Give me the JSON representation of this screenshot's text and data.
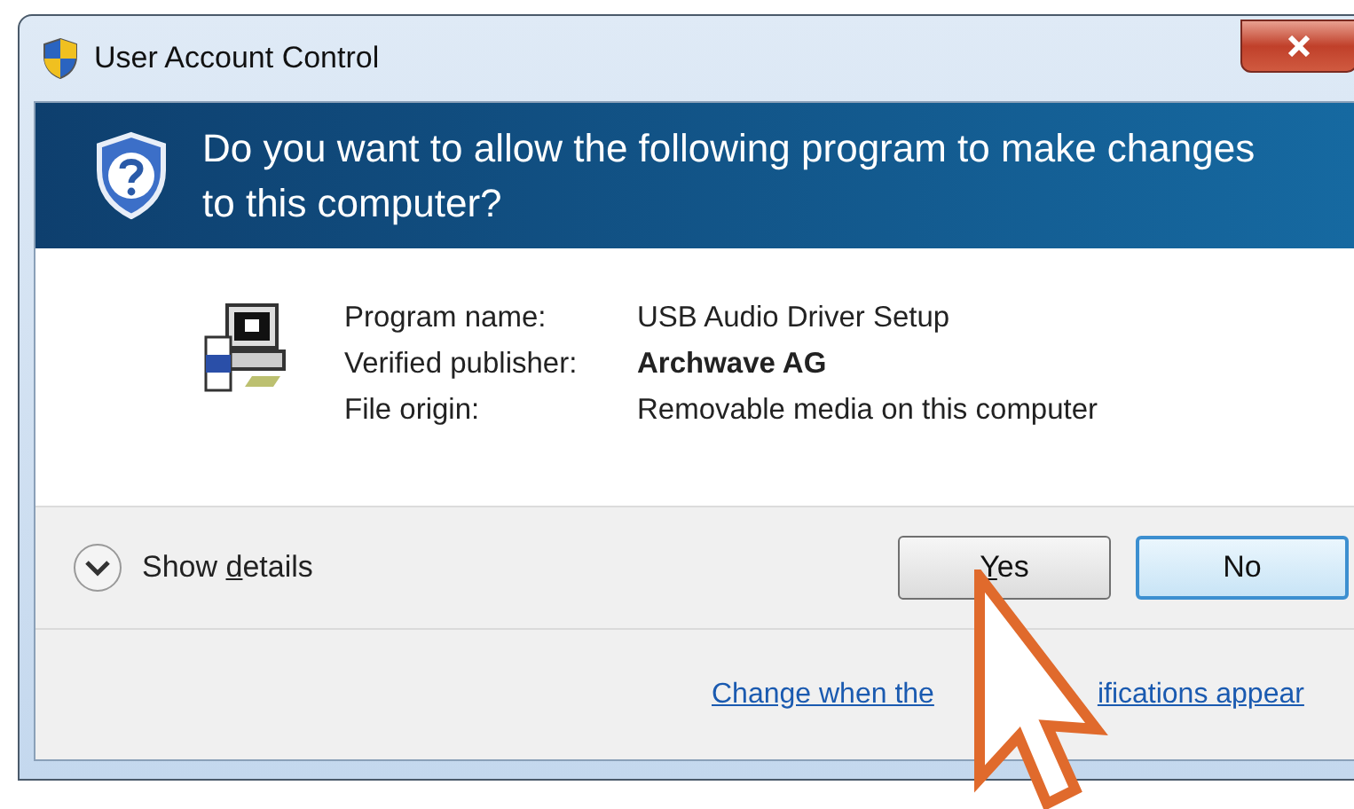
{
  "window": {
    "title": "User Account Control"
  },
  "header": {
    "question": "Do you want to allow the following program to make changes to this computer?"
  },
  "details": [
    {
      "label": "Program name:",
      "value": "USB Audio Driver Setup",
      "bold": false
    },
    {
      "label": "Verified publisher:",
      "value": "Archwave AG",
      "bold": true
    },
    {
      "label": "File origin:",
      "value": "Removable media on this computer",
      "bold": false
    }
  ],
  "show_details": {
    "parts": [
      {
        "text": "Show ",
        "underline": false
      },
      {
        "text": "d",
        "underline": true
      },
      {
        "text": "etails",
        "underline": false
      }
    ],
    "expanded": false
  },
  "buttons": [
    {
      "parts": [
        {
          "text": "Y",
          "underline": true
        },
        {
          "text": "es",
          "underline": false
        }
      ],
      "focused": false
    },
    {
      "parts": [
        {
          "text": "No",
          "underline": false
        }
      ],
      "focused": true
    }
  ],
  "link": {
    "visible_parts": [
      "Change when the",
      "ifications appear"
    ]
  }
}
